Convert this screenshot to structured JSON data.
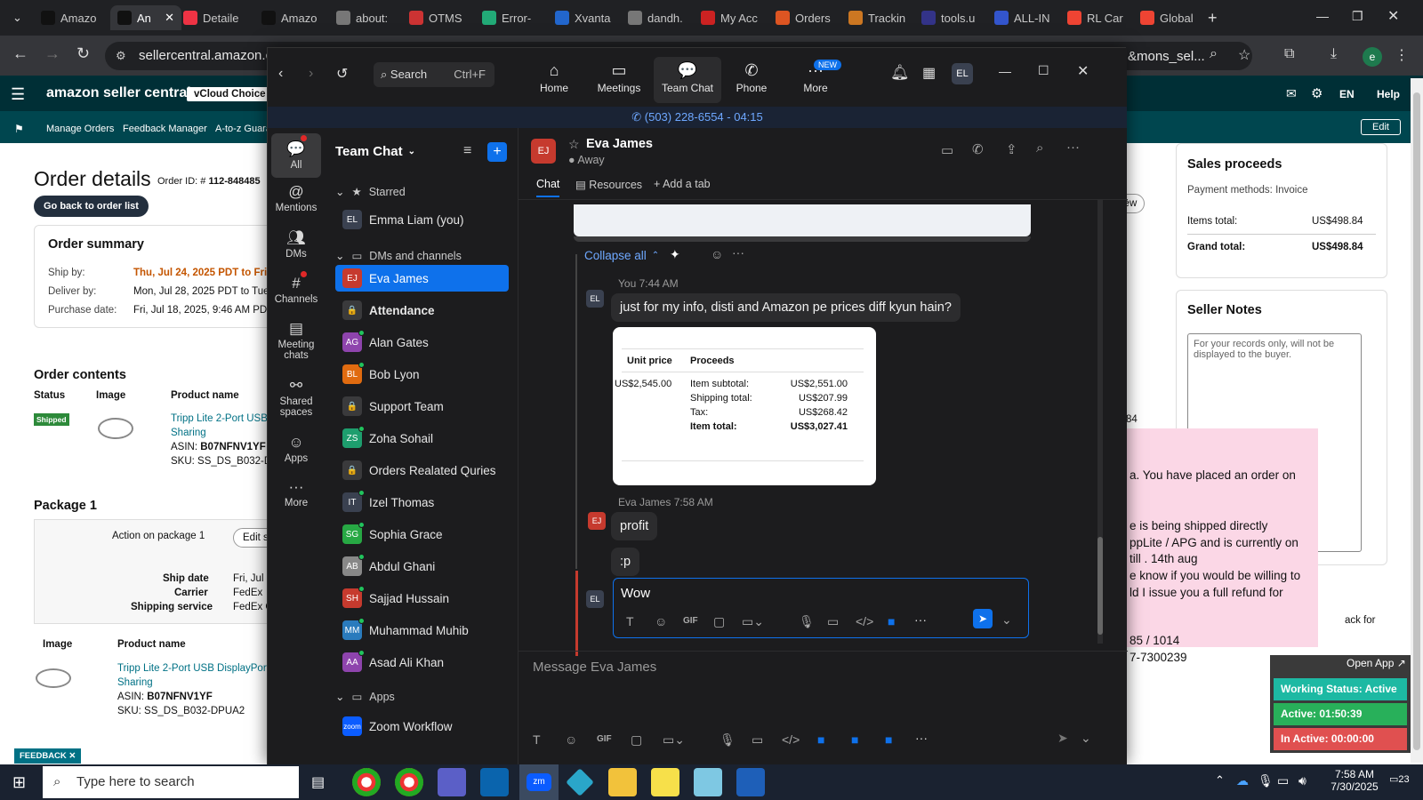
{
  "browser": {
    "tabs": [
      {
        "label": "Amazo",
        "color": "#111"
      },
      {
        "label": "An",
        "color": "#111",
        "active": true
      },
      {
        "label": "Detaile",
        "color": "#e34"
      },
      {
        "label": "Amazo",
        "color": "#111"
      },
      {
        "label": "about:",
        "color": "#777"
      },
      {
        "label": "OTMS",
        "color": "#c33"
      },
      {
        "label": "Error-",
        "color": "#2a7"
      },
      {
        "label": "Xvanta",
        "color": "#26c"
      },
      {
        "label": "dandh.",
        "color": "#777"
      },
      {
        "label": "My Acc",
        "color": "#c22"
      },
      {
        "label": "Orders",
        "color": "#d52"
      },
      {
        "label": "Trackin",
        "color": "#c72"
      },
      {
        "label": "tools.u",
        "color": "#338"
      },
      {
        "label": "ALL-IN",
        "color": "#35c"
      },
      {
        "label": "RL Car",
        "color": "#e43"
      },
      {
        "label": "Global",
        "color": "#e43"
      }
    ],
    "url": "sellercentral.amazon.co",
    "url_right": "&mons_sel..."
  },
  "seller": {
    "brand": "amazon seller central",
    "store": "vCloud Choice",
    "nav": [
      "Manage Orders",
      "Feedback Manager",
      "A-to-z Guara"
    ],
    "lang": "EN",
    "help": "Help",
    "edit": "Edit",
    "title": "Order details",
    "order_id_label": "Order ID: #",
    "order_id": "112-848485",
    "back": "Go back to order list",
    "summary_title": "Order summary",
    "ship_by_label": "Ship by:",
    "ship_by": "Thu, Jul 24, 2025 PDT to Fri,",
    "deliver_by_label": "Deliver by:",
    "deliver_by": "Mon, Jul 28, 2025 PDT to Tue",
    "purchase_label": "Purchase date:",
    "purchase": "Fri, Jul 18, 2025, 9:46 AM PDT",
    "contents_title": "Order contents",
    "col_status": "Status",
    "col_image": "Image",
    "col_product": "Product name",
    "status_badge": "Shipped",
    "product": "Tripp Lite 2-Port USB",
    "product2": "Sharing",
    "asin_label": "ASIN:",
    "asin": "B07NFNV1YF",
    "sku_label": "SKU:",
    "sku": "SS_DS_B032-DP",
    "package_title": "Package 1",
    "action_pkg": "Action on package 1",
    "edit_btn": "Edit s",
    "ship_date_label": "Ship date",
    "ship_date": "Fri, Jul 2",
    "carrier_label": "Carrier",
    "carrier": "FedEx",
    "service_label": "Shipping service",
    "service": "FedEx G",
    "col_image2": "Image",
    "col_product2": "Product name",
    "product_b": "Tripp Lite 2-Port USB DisplayPort",
    "product_b2": "Sharing",
    "asin_b": "B07NFNV1YF",
    "sku_b": "SS_DS_B032-DPUA2",
    "feedback": "FEEDBACK",
    "view_btn": "iew",
    "sales_title": "Sales proceeds",
    "pay_method": "Payment methods: Invoice",
    "items_total_label": "Items total:",
    "items_total": "US$498.84",
    "grand_total_label": "Grand total:",
    "grand_total": "US$498.84",
    "notes_title": "Seller Notes",
    "notes_placeholder": "For your records only, will not be displayed to the buyer.",
    "side_84": "84",
    "side_ack": "ack for"
  },
  "sticky": {
    "lines": [
      "a. You have placed an order on",
      "e is being shipped directly",
      "ppLite /  APG and is currently on",
      "till . 14th aug",
      "e know if you would be willing to",
      "ld I issue you a full refund for",
      "85 / 1014",
      "7-7300239"
    ]
  },
  "widget": {
    "open_app": "Open App ↗",
    "working": "Working Status: Active",
    "active": "Active: 01:50:39",
    "inactive": "In Active: 00:00:00"
  },
  "zoom": {
    "search": "Search",
    "search_shortcut": "Ctrl+F",
    "tabs": [
      "Home",
      "Meetings",
      "Team Chat",
      "Phone",
      "More"
    ],
    "new_badge": "NEW",
    "me_initials": "EL",
    "call": "(503) 228-6554 - 04:15",
    "rail": [
      "All",
      "Mentions",
      "DMs",
      "Channels",
      "Meeting chats",
      "Shared spaces",
      "Apps",
      "More"
    ],
    "list_title": "Team Chat",
    "starred": "Starred",
    "dms": "DMs and channels",
    "apps_section": "Apps",
    "contacts": [
      {
        "name": "Emma Liam (you)",
        "ini": "EL",
        "color": "#3a4150"
      },
      {
        "name": "Eva James",
        "ini": "EJ",
        "color": "#c63a2e"
      },
      {
        "name": "Attendance",
        "ini": "🔒",
        "color": "#3a3a3c"
      },
      {
        "name": "Alan Gates",
        "ini": "AG",
        "color": "#8e44ad"
      },
      {
        "name": "Bob Lyon",
        "ini": "BL",
        "color": "#e06b10"
      },
      {
        "name": "Support Team",
        "ini": "🔒",
        "color": "#3a3a3c"
      },
      {
        "name": "Zoha Sohail",
        "ini": "ZS",
        "color": "#1e9e6e"
      },
      {
        "name": "Orders Realated Quries",
        "ini": "🔒",
        "color": "#3a3a3c"
      },
      {
        "name": "Izel Thomas",
        "ini": "IT",
        "color": "#3a4150"
      },
      {
        "name": "Sophia Grace",
        "ini": "SG",
        "color": "#27a844"
      },
      {
        "name": "Abdul Ghani",
        "ini": "AB",
        "color": "#888"
      },
      {
        "name": "Sajjad Hussain",
        "ini": "SH",
        "color": "#c63a2e"
      },
      {
        "name": "Muhammad Muhib",
        "ini": "MM",
        "color": "#2a7bbd"
      },
      {
        "name": "Asad Ali Khan",
        "ini": "AA",
        "color": "#8e44ad"
      }
    ],
    "app_item": {
      "name": "Zoom Workflow",
      "ini": "zoom",
      "color": "#0b5cff"
    },
    "chat_name": "Eva James",
    "chat_ini": "EJ",
    "chat_status": "Away",
    "chat_tabs": [
      "Chat",
      "Resources",
      "Add a tab"
    ],
    "collapse": "Collapse all",
    "msg1_meta": "You 7:44 AM",
    "msg1": "just for my info, disti and Amazon pe prices diff kyun hain?",
    "table": {
      "h_unit": "Unit price",
      "h_proceeds": "Proceeds",
      "unit_price": "US$2,545.00",
      "rows": [
        {
          "label": "Item subtotal:",
          "value": "US$2,551.00"
        },
        {
          "label": "Shipping total:",
          "value": "US$207.99"
        },
        {
          "label": "Tax:",
          "value": "US$268.42"
        },
        {
          "label": "Item total:",
          "value": "US$3,027.41"
        }
      ]
    },
    "msg2_meta": "Eva James 7:58 AM",
    "msg2": "profit",
    "msg3": ":p",
    "draft": "Wow",
    "compose_placeholder": "Message Eva James",
    "gif": "GIF"
  },
  "taskbar": {
    "search": "Type here to search",
    "time": "7:58 AM",
    "date": "7/30/2025",
    "notif": "23"
  }
}
